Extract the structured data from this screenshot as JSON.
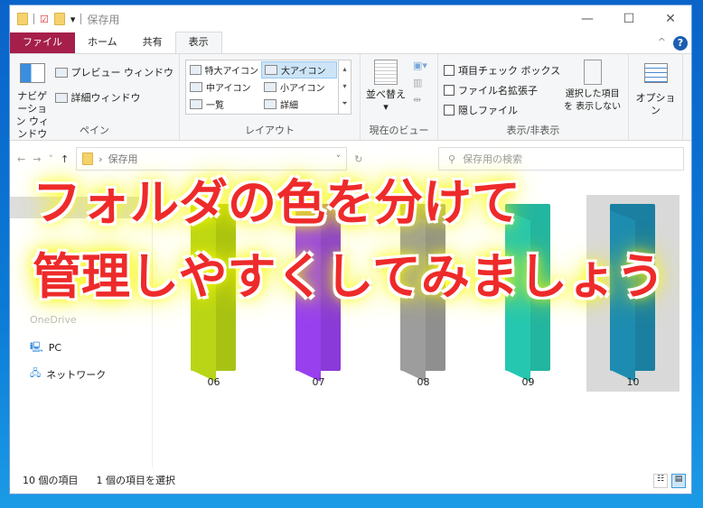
{
  "title": "保存用",
  "window_controls": {
    "minimize": "—",
    "maximize": "☐",
    "close": "✕",
    "help": "?",
    "collapse": "^"
  },
  "tabs": [
    "ファイル",
    "ホーム",
    "共有",
    "表示"
  ],
  "ribbon": {
    "pane": {
      "nav_pane": "ナビゲーション ウィンドウ",
      "preview": "プレビュー ウィンドウ",
      "details": "詳細ウィンドウ",
      "label": "ペイン"
    },
    "layout": {
      "items": [
        "特大アイコン",
        "大アイコン",
        "中アイコン",
        "小アイコン",
        "一覧",
        "詳細"
      ],
      "selected": "大アイコン",
      "label": "レイアウト"
    },
    "current_view": {
      "sort": "並べ替え",
      "label": "現在のビュー"
    },
    "show_hide": {
      "checkboxes": [
        "項目チェック ボックス",
        "ファイル名拡張子",
        "隠しファイル"
      ],
      "hide_selected": "選択した項目を 表示しない",
      "label": "表示/非表示"
    },
    "options": "オプション"
  },
  "address": {
    "path": "保存用",
    "search_placeholder": "保存用の検索"
  },
  "sidebar": {
    "items": [
      "OneDrive",
      "PC",
      "ネットワーク"
    ]
  },
  "folders": [
    {
      "name": "06",
      "color": "#a8c214"
    },
    {
      "name": "07",
      "color": "#8a3ad8"
    },
    {
      "name": "08",
      "color": "#8f8f8f"
    },
    {
      "name": "09",
      "color": "#22b5a0"
    },
    {
      "name": "10",
      "color": "#1a7fa0",
      "selected": true
    }
  ],
  "status": {
    "count": "10 個の項目",
    "selected": "1 個の項目を選択"
  },
  "overlay": {
    "line1": "フォルダの色を分けて",
    "line2": "管理しやすくしてみましょう"
  }
}
